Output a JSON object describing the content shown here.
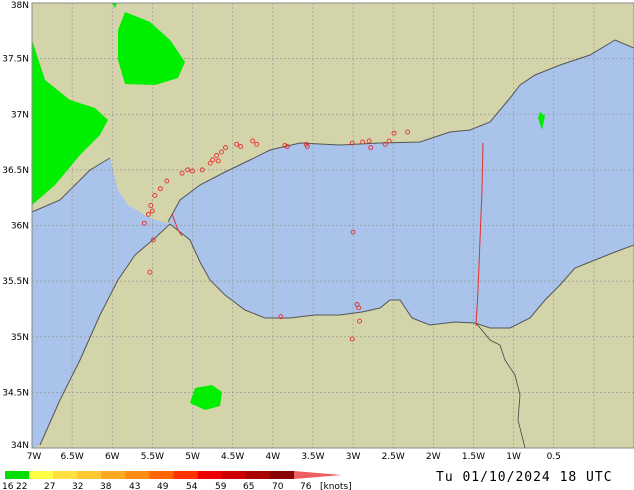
{
  "map": {
    "lon_range": [
      -7,
      0.5
    ],
    "lat_range": [
      34,
      38
    ],
    "lon_labels": [
      "7W",
      "6.5W",
      "6W",
      "5.5W",
      "5W",
      "4.5W",
      "4W",
      "3.5W",
      "3W",
      "2.5W",
      "2W",
      "1.5W",
      "1W",
      "0.5"
    ],
    "lat_labels": [
      "38N",
      "37.5N",
      "37N",
      "36.5N",
      "36N",
      "35.5N",
      "35N",
      "34.5N",
      "34N"
    ],
    "colors": {
      "land": "#d4d4aa",
      "sea": "#a9c3ea",
      "grid": "#9a9a9a",
      "coast": "#555555",
      "border": "#444444",
      "cut_line": "#e23030",
      "station": "#e23030",
      "wind_green": "#00ee00"
    }
  },
  "legend": {
    "labels": [
      "16",
      "22",
      "27",
      "32",
      "38",
      "43",
      "49",
      "54",
      "59",
      "65",
      "70",
      "76",
      "[knots]"
    ],
    "colors": [
      "#00dd00",
      "#ffff44",
      "#ffe040",
      "#ffc830",
      "#ffa820",
      "#ff8c10",
      "#ff6600",
      "#ff3300",
      "#ee0000",
      "#cc0000",
      "#aa0000",
      "#880000"
    ]
  },
  "timestamp": "Tu 01/10/2024 18 UTC"
}
